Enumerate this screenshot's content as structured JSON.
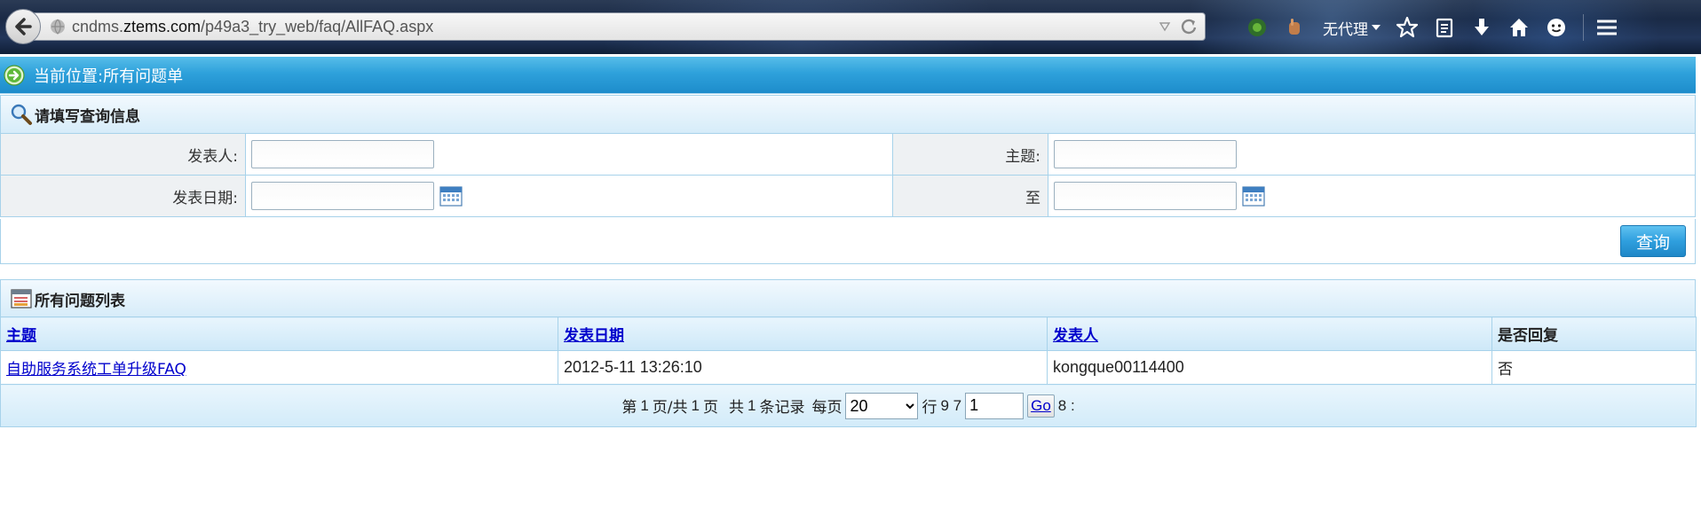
{
  "browser": {
    "url_prefix": "cndms.",
    "url_host": "ztems.com",
    "url_path": "/p49a3_try_web/faq/AllFAQ.aspx",
    "proxy_label": "无代理"
  },
  "location": {
    "text": "当前位置:所有问题单"
  },
  "search": {
    "header": "请填写查询信息",
    "poster_label": "发表人:",
    "subject_label": "主题:",
    "date_label": "发表日期:",
    "to_label": "至",
    "poster_value": "",
    "subject_value": "",
    "date_from_value": "",
    "date_to_value": "",
    "query_button": "查询"
  },
  "list": {
    "header": "所有问题列表",
    "columns": [
      "主题",
      "发表日期",
      "发表人",
      "是否回复"
    ],
    "rows": [
      {
        "subject": "自助服务系统工单升级FAQ",
        "date": "2012-5-11 13:26:10",
        "poster": "kongque00114400",
        "replied": "否"
      }
    ]
  },
  "pager": {
    "page_prefix": "第",
    "current_page": "1",
    "page_mid": "页/共",
    "total_pages": "1",
    "page_suffix": "页",
    "records_prefix": "共",
    "total_records": "1",
    "records_suffix": "条记录",
    "per_page_label": "每页",
    "per_page_value": "20",
    "per_page_options": [
      "20"
    ],
    "row_label": "行",
    "extra_a": "9 7",
    "goto_value": "1",
    "go_label": "Go",
    "extra_b": "8 :"
  }
}
